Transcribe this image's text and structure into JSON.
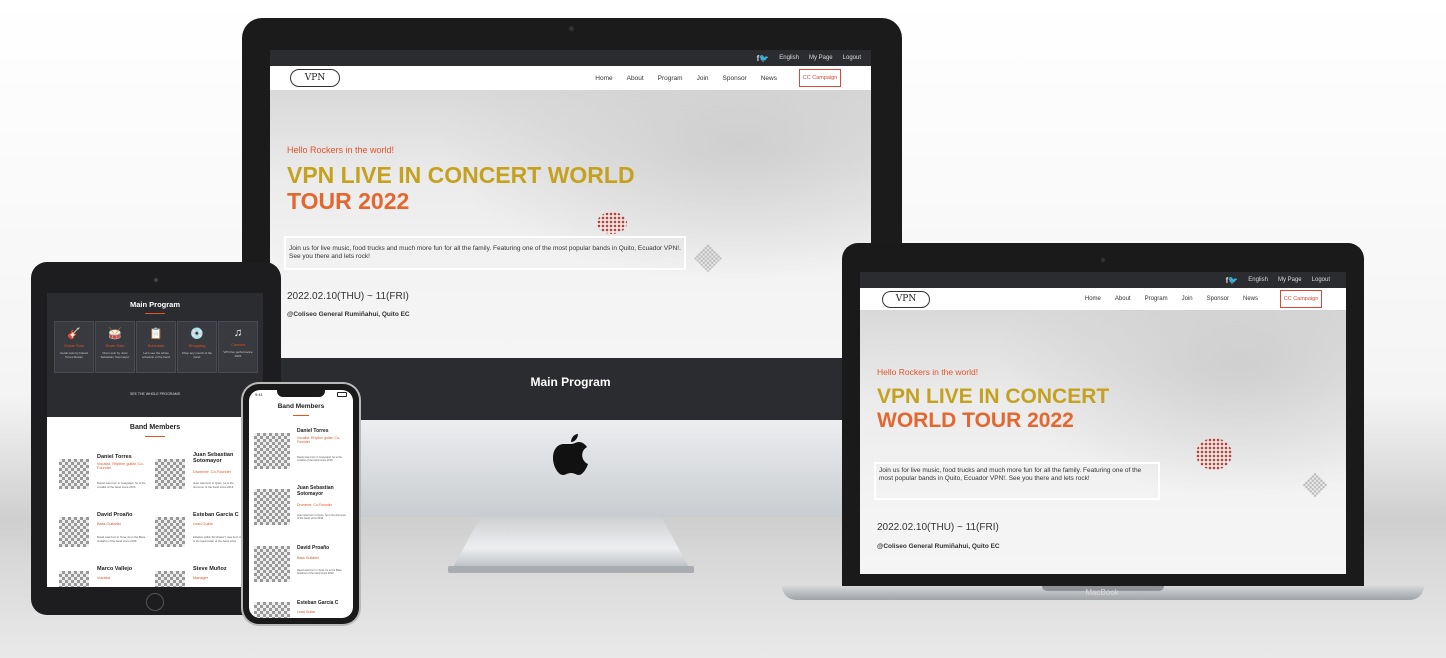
{
  "site": {
    "topbar": {
      "social": "f🐦",
      "language": "English",
      "mypage": "My Page",
      "logout": "Logout"
    },
    "logo": "VPN",
    "nav": [
      "Home",
      "About",
      "Program",
      "Join",
      "Sponsor",
      "News"
    ],
    "cc_button": "CC Campaign",
    "hero": {
      "hello": "Hello Rockers in the world!",
      "title_line1": "VPN LIVE IN CONCERT WORLD",
      "title_line2": "TOUR 2022",
      "mb_title_line1": "VPN LIVE IN CONCERT",
      "mb_title_line2": "WORLD TOUR 2022",
      "description": "Join us for live music, food trucks and much more fun for all the family. Featuring one of the most popular bands in Quito, Ecuador VPN!. See you there and lets rock!",
      "date": "2022.02.10(THU) ~ 11(FRI)",
      "venue": "@Coliseo General Rumiñahui, Quito EC"
    },
    "main_program": "Main Program"
  },
  "ipad": {
    "main_program": "Main Program",
    "cards": [
      {
        "icon": "guitar-icon",
        "title": "Guitar Solo",
        "text": "Guitar solo by Daniel Torres Ruban"
      },
      {
        "icon": "drum-icon",
        "title": "Drum Solo",
        "text": "Drum solo by Juan Sebastian Sotomayor"
      },
      {
        "icon": "schedule-icon",
        "title": "Schedule",
        "text": "Let's see the whole schedule of the band"
      },
      {
        "icon": "shopping-icon",
        "title": "Shopping",
        "text": "Shop any merch of the band"
      },
      {
        "icon": "music-note-icon",
        "title": "Concert",
        "text": "VPN live performance 2022"
      }
    ],
    "see_all": "SEE THE WHOLE PROGRAMS",
    "band_members": "Band Members",
    "members": [
      {
        "name": "Daniel Torres",
        "role": "Vocalist, Rhythm guitar, Co-Founder",
        "text": "Daniel was born in Guayaquil, he is the vocalist of the band since 2016"
      },
      {
        "name": "Juan Sebastian Sotomayor",
        "role": "Drummer, Co-Founder",
        "text": "Juan was born in Quito, he is the drummer of the band since 2016"
      },
      {
        "name": "David Proaño",
        "role": "Bass Guitarist",
        "text": "David was born in Tena, he is the Bass Guitarist of the band since 2019"
      },
      {
        "name": "Esteban García C",
        "role": "Lead Guitar",
        "text": "Esteban (AKA \"El Chatox\") was born in is the lead Guitar of the band since"
      },
      {
        "name": "Marco Vallejo",
        "role": "Vocalist",
        "text": ""
      },
      {
        "name": "Steve Muñoz",
        "role": "Manager",
        "text": ""
      }
    ]
  },
  "iphone": {
    "time": "9:41",
    "band_members": "Band Members",
    "members": [
      {
        "name": "Daniel Torres",
        "role": "Vocalist, Rhythm guitar, Co-Founder",
        "text": "Daniel was born in Guayaquil, he is the vocalist of the band since 2016"
      },
      {
        "name": "Juan Sebastian Sotomayor",
        "role": "Drummer, Co-Founder",
        "text": "Juan was born in Quito, he is the drummer of the band since 2016"
      },
      {
        "name": "David Proaño",
        "role": "Bass Guitarist",
        "text": "David was born in Tena, he is the Bass Guitarist of the band since 2019"
      },
      {
        "name": "Esteban García C",
        "role": "Lead Guitar",
        "text": ""
      }
    ]
  },
  "macbook": {
    "brand": "MacBook"
  },
  "colors": {
    "accent": "#e3542b",
    "gold": "#c4a21f",
    "dark": "#2b2c30",
    "cc_red": "#e0443a"
  }
}
